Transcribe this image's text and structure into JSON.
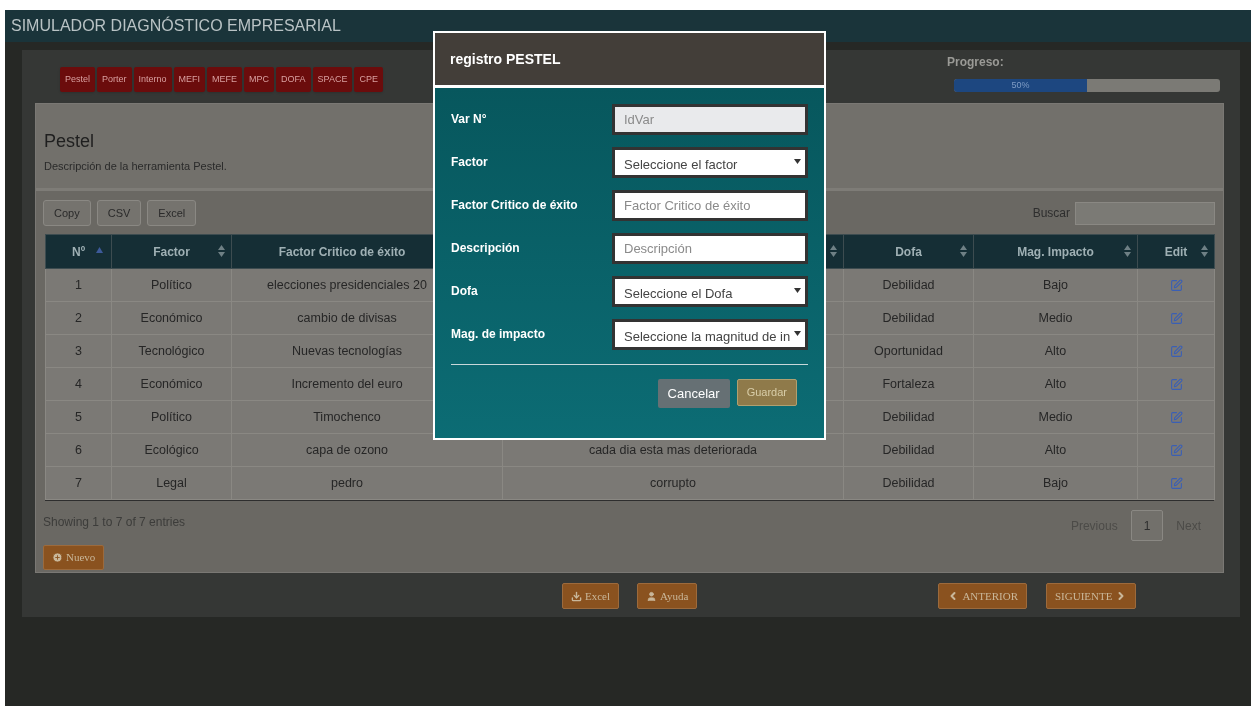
{
  "app": {
    "title": "SIMULADOR DIAGNÓSTICO EMPRESARIAL"
  },
  "nav_tabs": [
    {
      "label": "Pestel"
    },
    {
      "label": "Porter"
    },
    {
      "label": "Interno"
    },
    {
      "label": "MEFI"
    },
    {
      "label": "MEFE"
    },
    {
      "label": "MPC"
    },
    {
      "label": "DOFA"
    },
    {
      "label": "SPACE"
    },
    {
      "label": "CPE"
    }
  ],
  "progress": {
    "label": "Progreso:",
    "level": 0.5,
    "reading": "50%"
  },
  "section": {
    "title": "Pestel",
    "description": "Descripción de la herramienta Pestel."
  },
  "toolbar": {
    "buttons": [
      "Copy",
      "CSV",
      "Excel"
    ],
    "search_label": "Buscar"
  },
  "table": {
    "columns": [
      {
        "label": "Nº",
        "sorted": true
      },
      {
        "label": "Factor",
        "sorted": false
      },
      {
        "label": "Factor Critico de éxito"
      },
      {
        "sorted": false
      },
      {
        "label": "Dofa",
        "sorted": false
      },
      {
        "label": "Mag. Impacto",
        "sorted": false
      },
      {
        "label": "Edit",
        "sorted": false
      }
    ],
    "rows": [
      {
        "n": "1",
        "factor": "Político",
        "critical_factor": "elecciones presidenciales 20",
        "dofa": "Debilidad",
        "impact": "Bajo"
      },
      {
        "n": "2",
        "factor": "Económico",
        "critical_factor": "cambio de divisas",
        "dofa": "Debilidad",
        "impact": "Medio"
      },
      {
        "n": "3",
        "factor": "Tecnológico",
        "critical_factor": "Nuevas tecnologías",
        "dofa": "Oportunidad",
        "impact": "Alto"
      },
      {
        "n": "4",
        "factor": "Económico",
        "critical_factor": "Incremento del euro",
        "dofa": "Fortaleza",
        "impact": "Alto"
      },
      {
        "n": "5",
        "factor": "Político",
        "critical_factor": "Timochenco",
        "dofa": "Debilidad",
        "impact": "Medio"
      },
      {
        "n": "6",
        "factor": "Ecológico",
        "critical_factor": "capa de ozono",
        "description": "cada dia esta mas deteriorada",
        "dofa": "Debilidad",
        "impact": "Alto"
      },
      {
        "n": "7",
        "factor": "Legal",
        "critical_factor": "pedro",
        "description": "corrupto",
        "dofa": "Debilidad",
        "impact": "Bajo"
      }
    ]
  },
  "footer": {
    "info": "Showing 1 to 7 of 7 entries",
    "pagination": [
      {
        "label": "Previous",
        "selected": false
      },
      {
        "label": "1",
        "selected": true
      },
      {
        "label": "Next",
        "selected": false
      }
    ]
  },
  "new_button": "Nuevo",
  "bottom_buttons": [
    {
      "label": "Excel",
      "kind": "download"
    },
    {
      "label": "Ayuda",
      "kind": "help"
    },
    {
      "label": "ANTERIOR",
      "kind": "prev"
    },
    {
      "label": "SIGUIENTE",
      "kind": "next"
    }
  ],
  "modal": {
    "title": "registro PESTEL",
    "fields": [
      {
        "label": "Var N°",
        "kind": "text",
        "placeholder": "IdVar",
        "disabled": true
      },
      {
        "label": "Factor",
        "kind": "select",
        "value": "Seleccione el factor"
      },
      {
        "label": "Factor Critico de éxito",
        "kind": "text",
        "placeholder": "Factor Critico de éxito",
        "disabled": false
      },
      {
        "label": "Descripción",
        "kind": "text",
        "placeholder": "Descripción",
        "disabled": false
      },
      {
        "label": "Dofa",
        "kind": "select",
        "value": "Seleccione el Dofa"
      },
      {
        "label": "Mag. de impacto",
        "kind": "select",
        "value": "Seleccione la magnitud de in"
      }
    ],
    "buttons": [
      {
        "label": "Cancelar",
        "kind": "cancel"
      },
      {
        "label": "Guardar",
        "kind": "save"
      }
    ]
  }
}
